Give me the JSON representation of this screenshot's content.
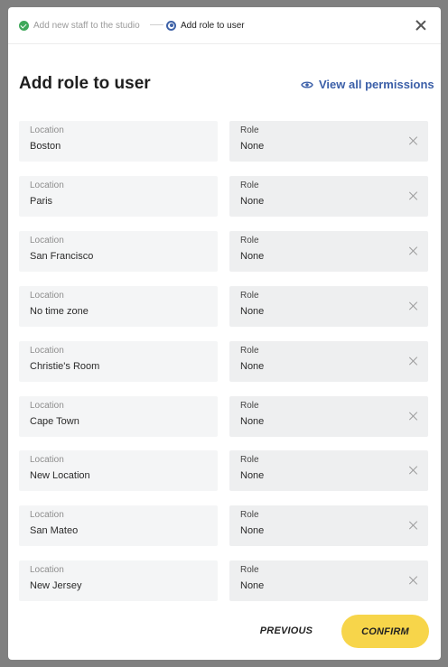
{
  "stepper": {
    "steps": [
      {
        "label": "Add new staff to the studio",
        "state": "done"
      },
      {
        "label": "Add role to user",
        "state": "current"
      }
    ]
  },
  "modal": {
    "title": "Add role to user",
    "view_permissions_label": "View all permissions"
  },
  "rows": [
    {
      "location_label": "Location",
      "location": "Boston",
      "role_label": "Role",
      "role": "None"
    },
    {
      "location_label": "Location",
      "location": "Paris",
      "role_label": "Role",
      "role": "None"
    },
    {
      "location_label": "Location",
      "location": "San Francisco",
      "role_label": "Role",
      "role": "None"
    },
    {
      "location_label": "Location",
      "location": "No time zone",
      "role_label": "Role",
      "role": "None"
    },
    {
      "location_label": "Location",
      "location": "Christie's Room",
      "role_label": "Role",
      "role": "None"
    },
    {
      "location_label": "Location",
      "location": "Cape Town",
      "role_label": "Role",
      "role": "None"
    },
    {
      "location_label": "Location",
      "location": "New Location",
      "role_label": "Role",
      "role": "None"
    },
    {
      "location_label": "Location",
      "location": "San Mateo",
      "role_label": "Role",
      "role": "None"
    },
    {
      "location_label": "Location",
      "location": "New Jersey",
      "role_label": "Role",
      "role": "None"
    }
  ],
  "footer": {
    "previous_label": "PREVIOUS",
    "confirm_label": "CONFIRM"
  },
  "colors": {
    "accent": "#3b5fa8",
    "confirm_bg": "#f7d54a",
    "step_done": "#3fa85a",
    "overlay": "#808080"
  }
}
